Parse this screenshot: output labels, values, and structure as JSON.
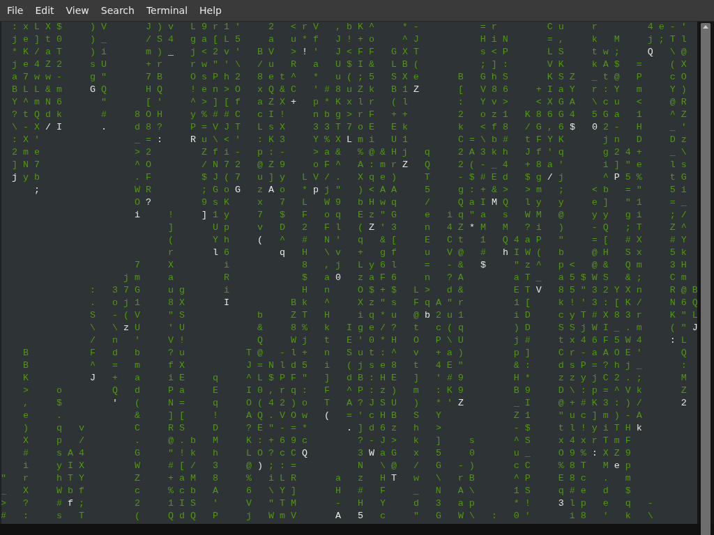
{
  "menu": [
    {
      "label": "File"
    },
    {
      "label": "Edit"
    },
    {
      "label": "View"
    },
    {
      "label": "Search"
    },
    {
      "label": "Terminal"
    },
    {
      "label": "Help"
    }
  ],
  "terminal": {
    "lines": [
      [
        {
          "text": "  : x L X $     ) V       J ) v   L 9 r 1 '     2   < r V   , b K ^     * -           = r         C u     r         4 e - '",
          "head": false
        }
      ],
      [
        {
          "text": "  j e ] t 0     ) _       / S 4   g a [ L 5     a   u * f   J ! + o     ^ J           H i N       = ,     k   M     j ; T l",
          "head": false
        }
      ],
      [
        {
          "text": "  * K / a T     ) i       m )",
          "head": false
        },
        {
          "text": " _",
          "head": true
        },
        {
          "text": "   j < 2 v '   B V   >",
          "head": false
        },
        {
          "text": " !",
          "head": true
        },
        {
          "text": " '   J < F F   G X T           s < P       L S     t w ;",
          "head": false
        },
        {
          "text": "     Q",
          "head": true
        },
        {
          "text": "   \\ @",
          "head": false
        }
      ],
      [
        {
          "text": "  j e 4 Z 2     s U       + r     r w \" ' \\   / u   R   a   U $ I &   L B (           ; ] :       V K     k A $   =     ( X",
          "head": false
        }
      ],
      [
        {
          "text": "  a 7 w w -     g \"       7 B     O s P h 2   8 e t ^   *   u ( ; 5   S X e       B   G h S       K S Z   _ t @   P     c O",
          "head": false
        }
      ],
      [
        {
          "text": "  B L L & m",
          "head": false
        },
        {
          "text": "     G",
          "head": true
        },
        {
          "text": " Q       H Q     ! e n > O   x Q & C   ' # 8 u Z k   B 1",
          "head": false
        },
        {
          "text": " Z",
          "head": true
        },
        {
          "text": "       [   V 8 6     + I a Y   r : Y   m     Y )",
          "head": false
        }
      ],
      [
        {
          "text": "  Y ^ m N 6       \"       [ '     ^ > ] [ f   a Z X",
          "head": false
        },
        {
          "text": " +",
          "head": true
        },
        {
          "text": "   p * K x l r   ( l         :   Y v >     < X G A   \\ c u   <     @ R",
          "head": false
        }
      ],
      [
        {
          "text": "  ? t Q d k       #     8 O H     y % # # C   c I !     n b g > r F   + +         2   o z 1   K 8 6 G 4   5 G a   1     ^ Z",
          "head": false
        }
      ],
      [
        {
          "text": "  \\ - X",
          "head": false
        },
        {
          "text": " / I",
          "head": true
        },
        {
          "text": "       .",
          "head": true
        },
        {
          "text": "     d 8 ?     P = V J T   L s X     3 3 T 7 o E   E k         k   < f 8   / G , 6",
          "head": false
        },
        {
          "text": " $",
          "head": true
        },
        {
          "text": "   0",
          "head": true
        },
        {
          "text": " 2 -   H     _ '",
          "head": false
        }
      ],
      [
        {
          "text": "  : X '                 _ =",
          "head": false
        },
        {
          "text": " :",
          "head": true
        },
        {
          "text": "     R",
          "head": true
        },
        {
          "text": " u \\ < '   : K 3     Y % X",
          "head": false
        },
        {
          "text": " L",
          "head": true
        },
        {
          "text": " m i   U 1         C = \\ b #   t F Y K       j n   D     D z",
          "head": false
        }
      ],
      [
        {
          "text": "  2 m e                 > 2         Z f i -   p : -     > a &   % @ & H j   q     2 A 3 k h   J f ' q       g 2 4 +     _ \\",
          "head": false
        }
      ],
      [
        {
          "text": "  ] N 7                 ^ O         / N 7 2   @ Z 9     o F ^   A : m r",
          "head": false
        },
        {
          "text": " Z",
          "head": true
        },
        {
          "text": "   Q     2 ( - _ 4   + 8 a '       i ] \" e     l s",
          "head": false
        }
      ],
      [
        {
          "text": "  j",
          "head": true
        },
        {
          "text": " y b                 . F         $ J ( 7   u ] y   L V / .   X q e )     T     - $ # E d   $ g",
          "head": false
        },
        {
          "text": " /",
          "head": true
        },
        {
          "text": " j       ^",
          "head": false
        },
        {
          "text": " P",
          "head": true
        },
        {
          "text": " 5 %     t G",
          "head": false
        }
      ],
      [
        {
          "text": "      ;",
          "head": true
        },
        {
          "text": "                 W R         ; G o",
          "head": false
        },
        {
          "text": " G",
          "head": true
        },
        {
          "text": "   z",
          "head": false
        },
        {
          "text": " A",
          "head": true
        },
        {
          "text": " o   *",
          "head": false
        },
        {
          "text": " p",
          "head": true
        },
        {
          "text": " j \"   ) < A A     5     g : + & >   > m   ;     < b   = \"     5 i",
          "head": false
        }
      ],
      [
        {
          "text": "                        O",
          "head": false
        },
        {
          "text": " ?",
          "head": true
        },
        {
          "text": "         9 s K     x   7   L   W 9   b H w q     /     Q a I",
          "head": false
        },
        {
          "text": " M",
          "head": true
        },
        {
          "text": " Q   l y   y     e ]   \" 1     = _",
          "head": false
        }
      ],
      [
        {
          "text": "                        i",
          "head": true
        },
        {
          "text": "     !",
          "head": false
        },
        {
          "text": "     ]",
          "head": true
        },
        {
          "text": " 1 y     7   $   F   o q   E z \" G     e   i q \" a   s   W M   @     y y   g i     ; /",
          "head": false
        }
      ],
      [
        {
          "text": "                              ]       U p     v   D   2   F l   (",
          "head": false
        },
        {
          "text": " Z",
          "head": true
        },
        {
          "text": " ' 3     n   4 Z",
          "head": false
        },
        {
          "text": " *",
          "head": true
        },
        {
          "text": " M   M   ? i   )     - Q   ; T     Z ^",
          "head": false
        }
      ],
      [
        {
          "text": "                              (       Y h",
          "head": false
        },
        {
          "text": "     (",
          "head": true
        },
        {
          "text": "   ^   #   N '   q   & [     E   C t   1   Q 4 a P   \"     = [   # X     # Y",
          "head": false
        }
      ],
      [
        {
          "text": "                              r",
          "head": false
        },
        {
          "text": "       l",
          "head": true
        },
        {
          "text": " 6",
          "head": false
        },
        {
          "text": "         q",
          "head": true
        },
        {
          "text": "   H   \\ v   +   g f     u   V @   #",
          "head": false
        },
        {
          "text": "   h",
          "head": true
        },
        {
          "text": " I W (   b     @ H   S x     5 k",
          "head": false
        }
      ],
      [
        {
          "text": "                        7     X         i             8   , j   L y 6 l     =   - &",
          "head": false
        },
        {
          "text": "   $",
          "head": true
        },
        {
          "text": "     \" z ^   p <   @ &   Q m     3 H",
          "head": false
        }
      ],
      [
        {
          "text": "                      j m     a         R             $   a",
          "head": false
        },
        {
          "text": " 0",
          "head": true
        },
        {
          "text": "   z a F 6     n   ? A         a T _   a 5 $ W S   & ;     C m",
          "head": false
        }
      ],
      [
        {
          "text": "                :   3 7 G     u g       i             H   n     O $ + $   L >   d &         E T",
          "head": false
        },
        {
          "text": " V",
          "head": true
        },
        {
          "text": "   8 5 \" 3 2 Y X n     R @ B",
          "head": false
        }
      ],
      [
        {
          "text": "                .   o j 1     8 X",
          "head": false
        },
        {
          "text": "       I",
          "head": true
        },
        {
          "text": "           B k   ^     X z \" s   F q A \" r         1 [     k ! ' 3 : [ K /     N 6 Q",
          "head": false
        }
      ],
      [
        {
          "text": "                S   - ( V     \" S             b     Z T   H     i q * u   @",
          "head": false
        },
        {
          "text": " b",
          "head": true
        },
        {
          "text": " 2 u 1         i D     c y T # X 8 3 r     K \" L",
          "head": false
        }
      ],
      [
        {
          "text": "                \\   \\",
          "head": false
        },
        {
          "text": " z",
          "head": true
        },
        {
          "text": " U     ' U             &     8 %   k   I g e / ?   t   c ( q         ) D     S S j W I _ . m     ( \"",
          "head": false
        },
        {
          "text": " J",
          "head": true
        }
      ],
      [
        {
          "text": "                /   n   '     V !             Q     W j   t   E ' 0 * H   O   P \\ U         j #     t x 4 6 F 5 W 4",
          "head": false
        },
        {
          "text": "     :",
          "head": true
        },
        {
          "text": " L",
          "head": false
        }
      ],
      [
        {
          "text": "    B           F   d   b     ? u           T @   - l +   n   S u t : ^   v   + a )         p ]     C r - a A O E '       Q",
          "head": false
        }
      ],
      [
        {
          "text": "    B           ^   =   m     f X           J = N l d 5   i   ( j s e 8   t   4 E \"         & :     d s P = ? h j _       :",
          "head": false
        }
      ],
      [
        {
          "text": "    K",
          "head": false
        },
        {
          "text": "           J",
          "head": true
        },
        {
          "text": "   +   a     i E     q     ^ L $ P F \"   ]   d B : H E   ]   ' # 9         H *     z z y j C 2 . ;       M",
          "head": false
        }
      ],
      [
        {
          "text": "    >     o         Q   d     P a     E     I 0 , r q :   F   ^ P : z )   m   : K 9         B 9     D \\ : p = ^ V k       Z",
          "head": false
        }
      ],
      [
        {
          "text": "    ,     $",
          "head": false
        },
        {
          "text": "         '",
          "head": true
        },
        {
          "text": "   (     N =     q     O ( 4 2 ) o   T   A ? J S U   )   * '",
          "head": false
        },
        {
          "text": " Z",
          "head": true
        },
        {
          "text": "         _ I     @ + # K 3 : ) /",
          "head": false
        },
        {
          "text": "       2",
          "head": true
        }
      ],
      [
        {
          "text": "    e     .             &     ] [     !     A Q . V O w",
          "head": false
        },
        {
          "text": "   (",
          "head": true
        },
        {
          "text": "   = ' c H B   S   Y             Z 1     \" u c ] m ) - A",
          "head": false
        }
      ],
      [
        {
          "text": "    )     q   v         C     R S     D     ? E \" - = *",
          "head": false
        },
        {
          "text": "       .",
          "head": true
        },
        {
          "text": " ] d 6 z   h   >             - $     t l ! y i T H",
          "head": false
        },
        {
          "text": " k",
          "head": true
        }
      ],
      [
        {
          "text": "    X     p   /         .     @ . b   M     K : + 6 9 c         ? - J >   k   ]     s       ^ S     x 4 x r T m F",
          "head": false
        }
      ],
      [
        {
          "text": "    #     s A 4         G     \" ! k   h     L O ? c C",
          "head": false
        },
        {
          "text": " Q",
          "head": true
        },
        {
          "text": "         3",
          "head": false
        },
        {
          "text": " W",
          "head": true
        },
        {
          "text": " a G   x   5     0       u _     O 9 %",
          "head": false
        },
        {
          "text": " :",
          "head": true
        },
        {
          "text": " X Z 9",
          "head": false
        }
      ],
      [
        {
          "text": "    i     y I X         W     # [ /   3     @",
          "head": false
        },
        {
          "text": " )",
          "head": true
        },
        {
          "text": " ; : =           N   \\ @   /   G   - )       c C     % 8 T   M",
          "head": false
        },
        {
          "text": " e",
          "head": true
        },
        {
          "text": " p",
          "head": false
        }
      ],
      [
        {
          "text": "\"   r     h T Y         Z     + a M   8     %   i L R       a   z   H",
          "head": false
        },
        {
          "text": " T",
          "head": true
        },
        {
          "text": "   w   \\   r B       ^ P     E 8 c   .   m",
          "head": false
        }
      ],
      [
        {
          "text": "_   X     W b f         c     % c b   A     6   \\ Y ]       H   #   F     _   N   A \\       1 S     q # e   d   $",
          "head": false
        }
      ],
      [
        {
          "text": ">   ?     #",
          "head": false
        },
        {
          "text": " f",
          "head": true
        },
        {
          "text": " ;         2     1 I S   '     V   \" T M       -   H   Y     d   3   a p       * !",
          "head": false
        },
        {
          "text": "     3",
          "head": true
        },
        {
          "text": " l p   e   q   -",
          "head": false
        }
      ],
      [
        {
          "text": "#   :     s   T         (     Q d Q   P     j   W m V",
          "head": false
        },
        {
          "text": "       A",
          "head": true
        },
        {
          "text": "   5",
          "head": true
        },
        {
          "text": "   c     \"   G   W \\   :   0 '       i 8   '   k   \\",
          "head": false
        }
      ]
    ]
  }
}
